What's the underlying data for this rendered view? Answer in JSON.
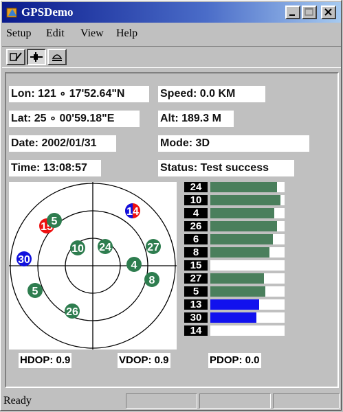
{
  "window": {
    "title": "GPSDemo"
  },
  "menu": [
    {
      "label": "Setup"
    },
    {
      "label": "Edit"
    },
    {
      "label": "View"
    },
    {
      "label": "Help"
    }
  ],
  "fields": {
    "lon": "Lon: 121 ∘ 17'52.64\"N",
    "speed": "Speed:  0.0 KM",
    "lat": "Lat: 25 ∘ 00'59.18\"E",
    "alt": "Alt: 189.3 M",
    "date": "Date: 2002/01/31",
    "mode": "Mode: 3D",
    "time": "Time: 13:08:57",
    "status": "Status: Test success"
  },
  "satellites": [
    {
      "id": "14",
      "color": "#ee1111",
      "accent": "#1111dd"
    },
    {
      "id": "15",
      "color": "#ee1111",
      "accent": "#ee1111"
    },
    {
      "id": "5",
      "color": "#2e7d4f"
    },
    {
      "id": "30",
      "color": "#1111dd"
    },
    {
      "id": "10",
      "color": "#2e7d4f"
    },
    {
      "id": "24",
      "color": "#2e7d4f"
    },
    {
      "id": "27",
      "color": "#2e7d4f"
    },
    {
      "id": "4",
      "color": "#2e7d4f"
    },
    {
      "id": "8",
      "color": "#2e7d4f"
    },
    {
      "id": "5",
      "color": "#2e7d4f"
    },
    {
      "id": "26",
      "color": "#2e7d4f"
    }
  ],
  "signal": [
    {
      "id": "24",
      "level": 0.9,
      "color": "#4a7f5c"
    },
    {
      "id": "10",
      "level": 0.94,
      "color": "#4a7f5c"
    },
    {
      "id": "4",
      "level": 0.86,
      "color": "#4a7f5c"
    },
    {
      "id": "26",
      "level": 0.9,
      "color": "#4a7f5c"
    },
    {
      "id": "6",
      "level": 0.84,
      "color": "#4a7f5c"
    },
    {
      "id": "8",
      "level": 0.8,
      "color": "#4a7f5c"
    },
    {
      "id": "15",
      "level": 0.0,
      "color": "#4a7f5c"
    },
    {
      "id": "27",
      "level": 0.72,
      "color": "#4a7f5c"
    },
    {
      "id": "5",
      "level": 0.74,
      "color": "#4a7f5c"
    },
    {
      "id": "13",
      "level": 0.66,
      "color": "#1111ee"
    },
    {
      "id": "30",
      "level": 0.62,
      "color": "#1111ee"
    },
    {
      "id": "14",
      "level": 0.0,
      "color": "#4a7f5c"
    }
  ],
  "dop": {
    "hdop": "HDOP: 0.9",
    "vdop": "VDOP: 0.9",
    "pdop": "PDOP: 0.0"
  },
  "statusbar": {
    "text": "Ready"
  }
}
